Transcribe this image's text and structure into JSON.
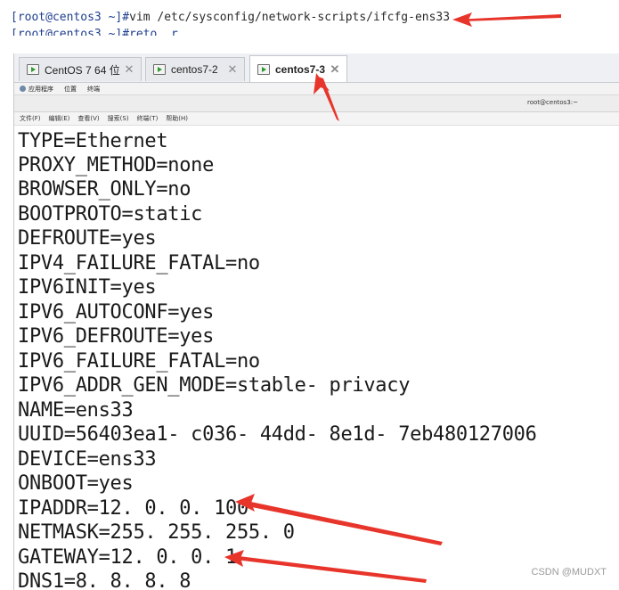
{
  "shell": {
    "prompt": "[root@centos3 ~]#",
    "command": "vim /etc/sysconfig/network-scripts/ifcfg-ens33",
    "next_line": "[root@centos3 ~]#reto  r"
  },
  "tabs": [
    {
      "label": "CentOS 7 64 位",
      "active": false
    },
    {
      "label": "centos7-2",
      "active": false
    },
    {
      "label": "centos7-3",
      "active": true
    }
  ],
  "tab_close_glyph": "✕",
  "app_menu": {
    "items": [
      "应用程序",
      "位置",
      "终端"
    ]
  },
  "window": {
    "title": "root@centos3:~"
  },
  "terminal_menu": {
    "items": [
      "文件(F)",
      "编辑(E)",
      "查看(V)",
      "搜索(S)",
      "终端(T)",
      "帮助(H)"
    ]
  },
  "config_lines": [
    "TYPE=Ethernet",
    "PROXY_METHOD=none",
    "BROWSER_ONLY=no",
    "BOOTPROTO=static",
    "DEFROUTE=yes",
    "IPV4_FAILURE_FATAL=no",
    "IPV6INIT=yes",
    "IPV6_AUTOCONF=yes",
    "IPV6_DEFROUTE=yes",
    "IPV6_FAILURE_FATAL=no",
    "IPV6_ADDR_GEN_MODE=stable- privacy",
    "NAME=ens33",
    "UUID=56403ea1- c036- 44dd- 8e1d- 7eb480127006",
    "DEVICE=ens33",
    "ONBOOT=yes",
    "IPADDR=12. 0. 0. 100",
    "NETMASK=255. 255. 255. 0",
    "GATEWAY=12. 0. 0. 1",
    "DNS1=8. 8. 8. 8"
  ],
  "watermark": "CSDN @MUDXT",
  "colors": {
    "annotation_arrow": "#e8352b",
    "prompt": "#1f3f8f"
  }
}
